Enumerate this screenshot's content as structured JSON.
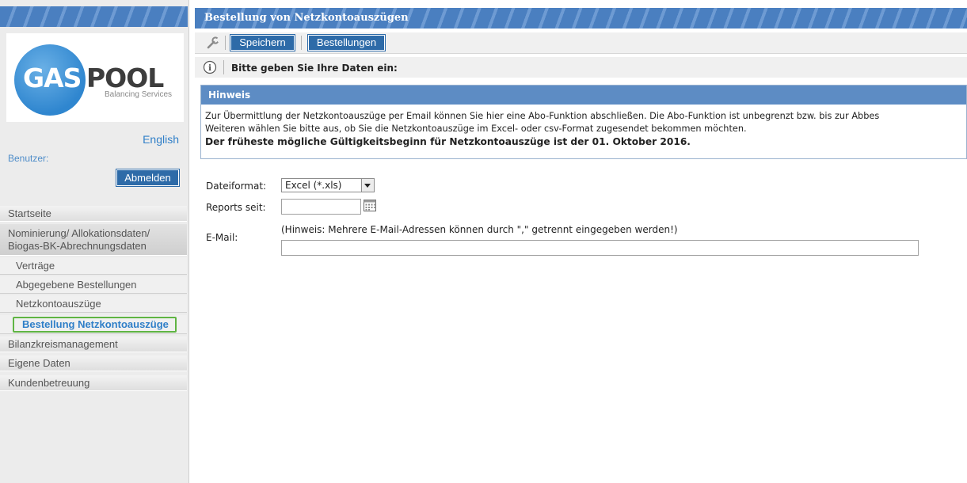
{
  "sidebar": {
    "logo": {
      "text_gas": "GAS",
      "text_pool": "POOL",
      "subtitle": "Balancing Services"
    },
    "language_link": "English",
    "user_label": "Benutzer:",
    "logout_button": "Abmelden",
    "nav": [
      {
        "label": "Startseite"
      },
      {
        "label_line1": "Nominierung/ Allokationsdaten/",
        "label_line2": "Biogas-BK-Abrechnungsdaten"
      },
      {
        "label": "Verträge"
      },
      {
        "label": "Abgegebene Bestellungen"
      },
      {
        "label": "Netzkontoauszüge"
      },
      {
        "label": "Bestellung Netzkontoauszüge"
      },
      {
        "label": "Bilanzkreismanagement"
      },
      {
        "label": "Eigene Daten"
      },
      {
        "label": "Kundenbetreuung"
      }
    ]
  },
  "main": {
    "title": "Bestellung von Netzkontoauszügen",
    "toolbar": {
      "save_label": "Speichern",
      "orders_label": "Bestellungen"
    },
    "info_text": "Bitte geben Sie Ihre Daten ein:",
    "hint": {
      "title": "Hinweis",
      "line1": "Zur Übermittlung der Netzkontoauszüge per Email können Sie hier eine Abo-Funktion abschließen. Die Abo-Funktion ist unbegrenzt bzw. bis zur Abbes",
      "line2": "Weiteren wählen Sie bitte aus, ob Sie die Netzkontoauszüge im Excel- oder csv-Format zugesendet bekommen möchten.",
      "line3": "Der früheste mögliche Gültigkeitsbeginn für Netzkontoauszüge ist der 01. Oktober 2016."
    },
    "form": {
      "format_label": "Dateiformat:",
      "format_value": "Excel (*.xls)",
      "reports_label": "Reports seit:",
      "reports_value": "",
      "email_label": "E-Mail:",
      "email_hint": "(Hinweis: Mehrere E-Mail-Adressen können durch \",\" getrennt eingegeben werden!)",
      "email_value": ""
    }
  },
  "colors": {
    "accent_blue": "#2e6ba8",
    "header_blue": "#5d8cc4",
    "active_outline": "#5fb443",
    "link_blue": "#2f7fc8"
  }
}
